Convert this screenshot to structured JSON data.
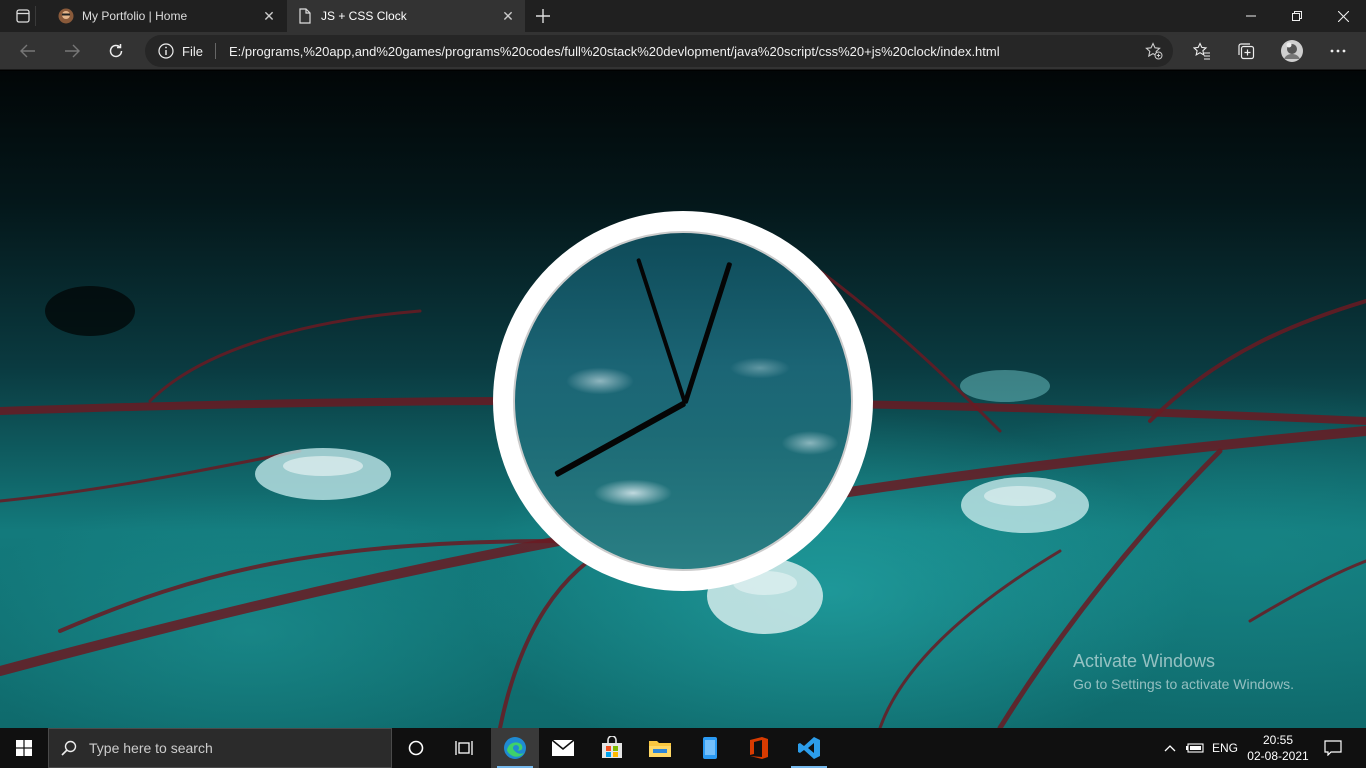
{
  "browser": {
    "tabs": [
      {
        "title": "My Portfolio | Home",
        "active": false
      },
      {
        "title": "JS + CSS Clock",
        "active": true
      }
    ],
    "address": {
      "scheme_label": "File",
      "url": "E:/programs,%20app,and%20games/programs%20codes/full%20stack%20devlopment/java%20script/css%20+js%20clock/index.html"
    }
  },
  "clock": {
    "time": {
      "hours": 8,
      "minutes": 2,
      "seconds": 57
    }
  },
  "watermark": {
    "line1": "Activate Windows",
    "line2": "Go to Settings to activate Windows."
  },
  "taskbar": {
    "search_placeholder": "Type here to search",
    "language": "ENG",
    "time": "20:55",
    "date": "02-08-2021"
  },
  "colors": {
    "edge_blue": "#1f8ad2",
    "vscode_blue": "#2c9dea",
    "office_red": "#d83b01"
  }
}
